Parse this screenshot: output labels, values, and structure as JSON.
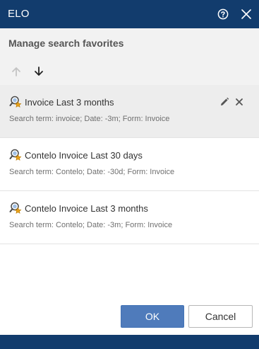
{
  "dialog": {
    "title": "ELO",
    "help_icon": "help-circle-icon",
    "close_icon": "close-icon"
  },
  "header": {
    "heading": "Manage search favorites",
    "move_up_icon": "arrow-up-icon",
    "move_down_icon": "arrow-down-icon"
  },
  "favorites": [
    {
      "title": "Invoice Last 3 months",
      "description": "Search term: invoice; Date: -3m; Form: Invoice",
      "icon": "search-favorite-icon",
      "selected": true
    },
    {
      "title": "Contelo Invoice Last 30 days",
      "description": "Search term: Contelo; Date: -30d; Form: Invoice",
      "icon": "search-favorite-icon",
      "selected": false
    },
    {
      "title": "Contelo Invoice Last 3 months",
      "description": "Search term: Contelo; Date: -3m; Form: Invoice",
      "icon": "search-favorite-icon",
      "selected": false
    }
  ],
  "item_actions": {
    "edit_icon": "pencil-icon",
    "remove_icon": "remove-icon"
  },
  "buttons": {
    "ok": "OK",
    "cancel": "Cancel"
  },
  "colors": {
    "titlebar": "#123c6d",
    "primary_button": "#4f7bbb",
    "selected_row": "#ededed",
    "header_background": "#f2f2f2",
    "disabled_icon": "#c4c4c4"
  }
}
